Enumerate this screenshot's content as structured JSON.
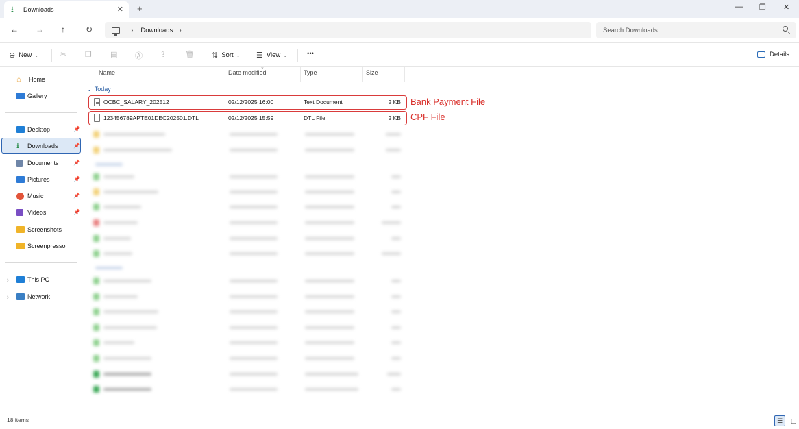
{
  "window": {
    "tab_title": "Downloads",
    "tab_close": "✕",
    "new_tab": "+",
    "minimize": "—",
    "maximize": "❐",
    "close": "✕"
  },
  "nav": {
    "back": "←",
    "forward": "→",
    "up": "↑",
    "refresh": "↻"
  },
  "address": {
    "separator": "›",
    "crumb": "Downloads",
    "trailing": "›"
  },
  "search": {
    "placeholder": "Search Downloads"
  },
  "commands": {
    "new_label": "New",
    "sort_label": "Sort",
    "view_label": "View",
    "more_label": "•••",
    "details_label": "Details"
  },
  "sidebar": {
    "home": "Home",
    "gallery": "Gallery",
    "pinned": [
      {
        "label": "Desktop",
        "color": "#1f7fd6"
      },
      {
        "label": "Downloads",
        "color": "#2f8f4f"
      },
      {
        "label": "Documents",
        "color": "#6f86a8"
      },
      {
        "label": "Pictures",
        "color": "#2e7bd6"
      },
      {
        "label": "Music",
        "color": "#e2543a"
      },
      {
        "label": "Videos",
        "color": "#7a4fc4"
      }
    ],
    "folders": [
      "Screenshots",
      "Screenpresso"
    ],
    "this_pc": "This PC",
    "network": "Network"
  },
  "columns": {
    "name": "Name",
    "date": "Date modified",
    "type": "Type",
    "size": "Size"
  },
  "group": {
    "label": "Today"
  },
  "files": [
    {
      "name": "OCBC_SALARY_202512",
      "date": "02/12/2025 16:00",
      "type": "Text Document",
      "size": "2 KB"
    },
    {
      "name": "123456789APTE01DEC202501.DTL",
      "date": "02/12/2025 15:59",
      "type": "DTL File",
      "size": "2 KB"
    }
  ],
  "annotations": {
    "bank": "Bank Payment File",
    "cpf": "CPF File"
  },
  "status": {
    "count": "18 items"
  },
  "colors": {
    "accent": "#2f66b3",
    "highlight": "#d93b3b",
    "selection": "#dce8f6"
  }
}
